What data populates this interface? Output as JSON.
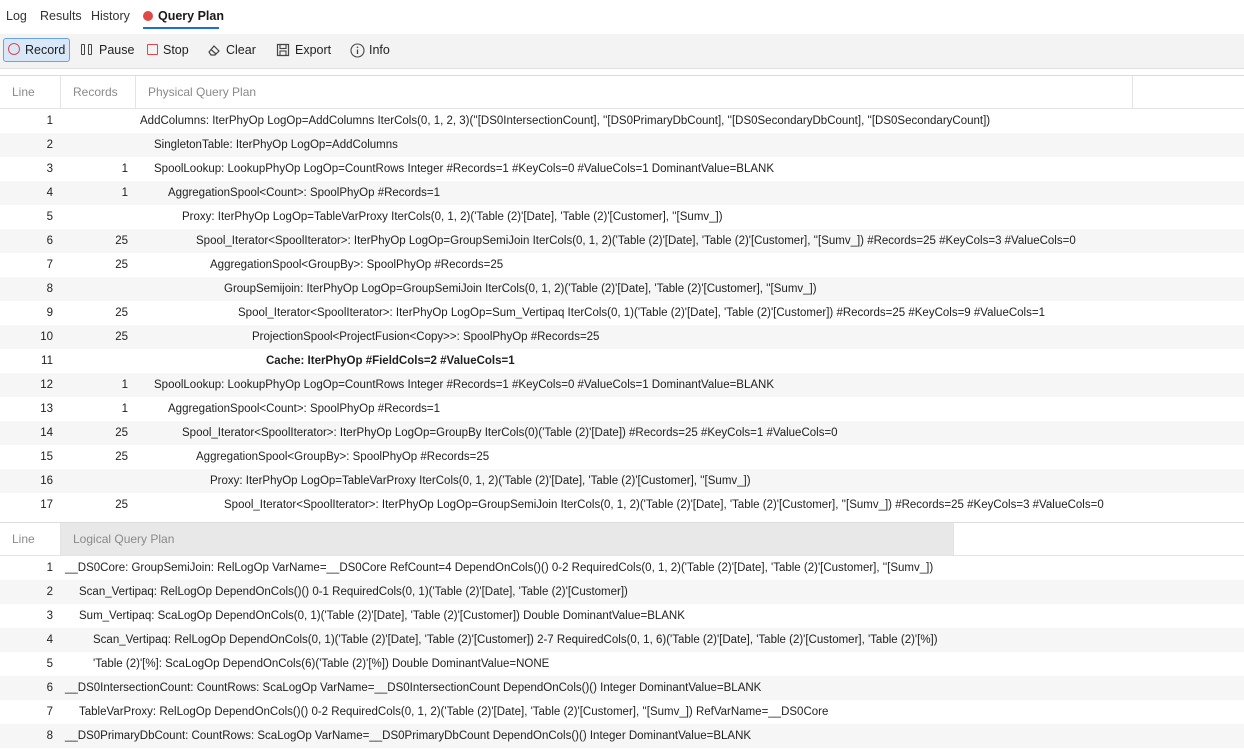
{
  "tabs": [
    {
      "label": "Log"
    },
    {
      "label": "Results"
    },
    {
      "label": "History"
    },
    {
      "label": "Query Plan",
      "active": true
    }
  ],
  "toolbar": {
    "record": "Record",
    "pause": "Pause",
    "stop": "Stop",
    "clear": "Clear",
    "export": "Export",
    "info": "Info"
  },
  "colors": {
    "accent": "#1e6fd0",
    "record_red": "#e04848",
    "selected_bg": "#d9e8f8"
  },
  "physical_plan": {
    "headers": {
      "line": "Line",
      "records": "Records",
      "plan": "Physical Query Plan"
    },
    "rows": [
      {
        "line": "1",
        "records": "",
        "indent": 0,
        "text": "AddColumns: IterPhyOp LogOp=AddColumns IterCols(0, 1, 2, 3)(''[DS0IntersectionCount], ''[DS0PrimaryDbCount], ''[DS0SecondaryDbCount], ''[DS0SecondaryCount])"
      },
      {
        "line": "2",
        "records": "",
        "indent": 1,
        "text": "SingletonTable: IterPhyOp LogOp=AddColumns"
      },
      {
        "line": "3",
        "records": "1",
        "indent": 1,
        "text": "SpoolLookup: LookupPhyOp LogOp=CountRows Integer #Records=1 #KeyCols=0 #ValueCols=1 DominantValue=BLANK"
      },
      {
        "line": "4",
        "records": "1",
        "indent": 2,
        "text": "AggregationSpool<Count>: SpoolPhyOp #Records=1"
      },
      {
        "line": "5",
        "records": "",
        "indent": 3,
        "text": "Proxy: IterPhyOp LogOp=TableVarProxy IterCols(0, 1, 2)('Table (2)'[Date], 'Table (2)'[Customer], ''[Sumv_])"
      },
      {
        "line": "6",
        "records": "25",
        "indent": 4,
        "text": "Spool_Iterator<SpoolIterator>: IterPhyOp LogOp=GroupSemiJoin IterCols(0, 1, 2)('Table (2)'[Date], 'Table (2)'[Customer], ''[Sumv_]) #Records=25 #KeyCols=3 #ValueCols=0"
      },
      {
        "line": "7",
        "records": "25",
        "indent": 5,
        "text": "AggregationSpool<GroupBy>: SpoolPhyOp #Records=25"
      },
      {
        "line": "8",
        "records": "",
        "indent": 6,
        "text": "GroupSemijoin: IterPhyOp LogOp=GroupSemiJoin IterCols(0, 1, 2)('Table (2)'[Date], 'Table (2)'[Customer], ''[Sumv_])"
      },
      {
        "line": "9",
        "records": "25",
        "indent": 7,
        "text": "Spool_Iterator<SpoolIterator>: IterPhyOp LogOp=Sum_Vertipaq IterCols(0, 1)('Table (2)'[Date], 'Table (2)'[Customer]) #Records=25 #KeyCols=9 #ValueCols=1"
      },
      {
        "line": "10",
        "records": "25",
        "indent": 8,
        "text": "ProjectionSpool<ProjectFusion<Copy>>: SpoolPhyOp #Records=25"
      },
      {
        "line": "11",
        "records": "",
        "indent": 9,
        "bold": true,
        "text": "Cache: IterPhyOp #FieldCols=2 #ValueCols=1"
      },
      {
        "line": "12",
        "records": "1",
        "indent": 1,
        "text": "SpoolLookup: LookupPhyOp LogOp=CountRows Integer #Records=1 #KeyCols=0 #ValueCols=1 DominantValue=BLANK"
      },
      {
        "line": "13",
        "records": "1",
        "indent": 2,
        "text": "AggregationSpool<Count>: SpoolPhyOp #Records=1"
      },
      {
        "line": "14",
        "records": "25",
        "indent": 3,
        "text": "Spool_Iterator<SpoolIterator>: IterPhyOp LogOp=GroupBy IterCols(0)('Table (2)'[Date]) #Records=25 #KeyCols=1 #ValueCols=0"
      },
      {
        "line": "15",
        "records": "25",
        "indent": 4,
        "text": "AggregationSpool<GroupBy>: SpoolPhyOp #Records=25"
      },
      {
        "line": "16",
        "records": "",
        "indent": 5,
        "text": "Proxy: IterPhyOp LogOp=TableVarProxy IterCols(0, 1, 2)('Table (2)'[Date], 'Table (2)'[Customer], ''[Sumv_])"
      },
      {
        "line": "17",
        "records": "25",
        "indent": 6,
        "text": "Spool_Iterator<SpoolIterator>: IterPhyOp LogOp=GroupSemiJoin IterCols(0, 1, 2)('Table (2)'[Date], 'Table (2)'[Customer], ''[Sumv_]) #Records=25 #KeyCols=3 #ValueCols=0"
      }
    ]
  },
  "logical_plan": {
    "headers": {
      "line": "Line",
      "plan": "Logical Query Plan"
    },
    "rows": [
      {
        "line": "1",
        "indent": 0,
        "text": "__DS0Core: GroupSemiJoin: RelLogOp VarName=__DS0Core RefCount=4 DependOnCols()() 0-2 RequiredCols(0, 1, 2)('Table (2)'[Date], 'Table (2)'[Customer], ''[Sumv_])"
      },
      {
        "line": "2",
        "indent": 1,
        "text": "Scan_Vertipaq: RelLogOp DependOnCols()() 0-1 RequiredCols(0, 1)('Table (2)'[Date], 'Table (2)'[Customer])"
      },
      {
        "line": "3",
        "indent": 1,
        "text": "Sum_Vertipaq: ScaLogOp DependOnCols(0, 1)('Table (2)'[Date], 'Table (2)'[Customer]) Double DominantValue=BLANK"
      },
      {
        "line": "4",
        "indent": 2,
        "text": "Scan_Vertipaq: RelLogOp DependOnCols(0, 1)('Table (2)'[Date], 'Table (2)'[Customer]) 2-7 RequiredCols(0, 1, 6)('Table (2)'[Date], 'Table (2)'[Customer], 'Table (2)'[%])"
      },
      {
        "line": "5",
        "indent": 2,
        "text": "'Table (2)'[%]: ScaLogOp DependOnCols(6)('Table (2)'[%]) Double DominantValue=NONE"
      },
      {
        "line": "6",
        "indent": 0,
        "text": "__DS0IntersectionCount: CountRows: ScaLogOp VarName=__DS0IntersectionCount DependOnCols()() Integer DominantValue=BLANK"
      },
      {
        "line": "7",
        "indent": 1,
        "text": "TableVarProxy: RelLogOp DependOnCols()() 0-2 RequiredCols(0, 1, 2)('Table (2)'[Date], 'Table (2)'[Customer], ''[Sumv_]) RefVarName=__DS0Core"
      },
      {
        "line": "8",
        "indent": 0,
        "text": "__DS0PrimaryDbCount: CountRows: ScaLogOp VarName=__DS0PrimaryDbCount DependOnCols()() Integer DominantValue=BLANK"
      }
    ]
  }
}
